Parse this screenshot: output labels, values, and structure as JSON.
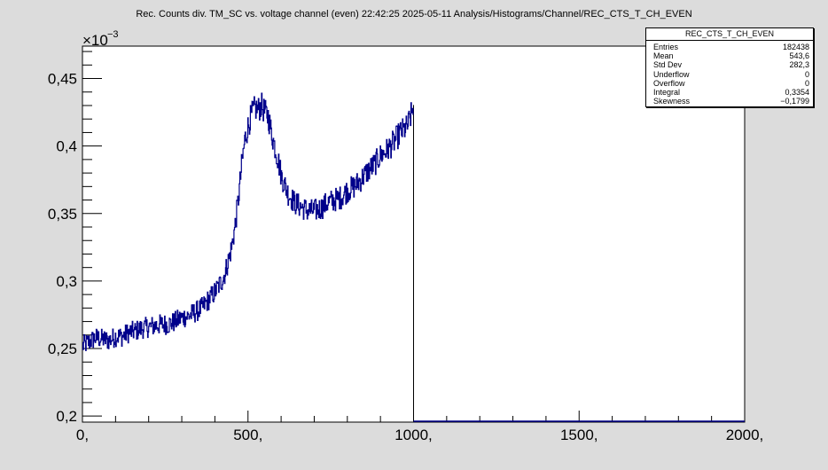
{
  "chart_data": {
    "type": "line",
    "title": "Rec. Counts div. TM_SC vs. voltage channel (even)  22:42:25  2025-05-11  Analysis/Histograms/Channel/REC_CTS_T_CH_EVEN",
    "xlim": [
      0,
      2000
    ],
    "ylim": [
      0.1955,
      0.474
    ],
    "y_multiplier": "×10",
    "y_exponent": "−3",
    "x_tick_labels": [
      {
        "value": 0,
        "label": "0,"
      },
      {
        "value": 500,
        "label": "500,"
      },
      {
        "value": 1000,
        "label": "1000,"
      },
      {
        "value": 1500,
        "label": "1500,"
      },
      {
        "value": 2000,
        "label": "2000,"
      }
    ],
    "y_tick_labels": [
      {
        "value": 0.2,
        "label": "0,2"
      },
      {
        "value": 0.25,
        "label": "0,25"
      },
      {
        "value": 0.3,
        "label": "0,3"
      },
      {
        "value": 0.35,
        "label": "0,35"
      },
      {
        "value": 0.4,
        "label": "0,4"
      },
      {
        "value": 0.45,
        "label": "0,45"
      }
    ],
    "line_color": "#00008b",
    "grid": false,
    "series": [
      {
        "x": [
          0,
          20,
          40,
          60,
          80,
          100,
          120,
          140,
          160,
          180,
          200,
          220,
          240,
          260,
          280,
          300,
          320,
          340,
          360,
          380,
          400,
          420,
          430,
          440,
          450,
          460,
          470,
          480,
          490,
          500,
          510,
          520,
          530,
          540,
          550,
          560,
          570,
          580,
          590,
          600,
          620,
          640,
          660,
          680,
          700,
          720,
          740,
          760,
          780,
          800,
          820,
          840,
          860,
          880,
          900,
          920,
          940,
          960,
          980,
          995,
          1000
        ],
        "y": [
          0.252,
          0.255,
          0.258,
          0.257,
          0.256,
          0.259,
          0.259,
          0.262,
          0.263,
          0.265,
          0.266,
          0.267,
          0.268,
          0.268,
          0.27,
          0.273,
          0.274,
          0.277,
          0.28,
          0.286,
          0.292,
          0.3,
          0.306,
          0.315,
          0.325,
          0.34,
          0.36,
          0.385,
          0.405,
          0.415,
          0.423,
          0.428,
          0.427,
          0.43,
          0.425,
          0.422,
          0.41,
          0.4,
          0.39,
          0.378,
          0.365,
          0.358,
          0.355,
          0.352,
          0.352,
          0.354,
          0.358,
          0.36,
          0.362,
          0.367,
          0.37,
          0.375,
          0.381,
          0.386,
          0.393,
          0.397,
          0.403,
          0.41,
          0.414,
          0.425,
          0.433
        ],
        "tail_x": [
          1000,
          2000
        ],
        "tail_y": [
          0.1955,
          0.1955
        ]
      }
    ],
    "stats": {
      "name": "REC_CTS_T_CH_EVEN",
      "rows": [
        {
          "label": "Entries",
          "value": "182438"
        },
        {
          "label": "Mean",
          "value": "543,6"
        },
        {
          "label": "Std Dev",
          "value": "282,3"
        },
        {
          "label": "Underflow",
          "value": "0"
        },
        {
          "label": "Overflow",
          "value": "0"
        },
        {
          "label": "Integral",
          "value": "0,3354"
        },
        {
          "label": "Skewness",
          "value": "−0,1799"
        }
      ]
    }
  }
}
